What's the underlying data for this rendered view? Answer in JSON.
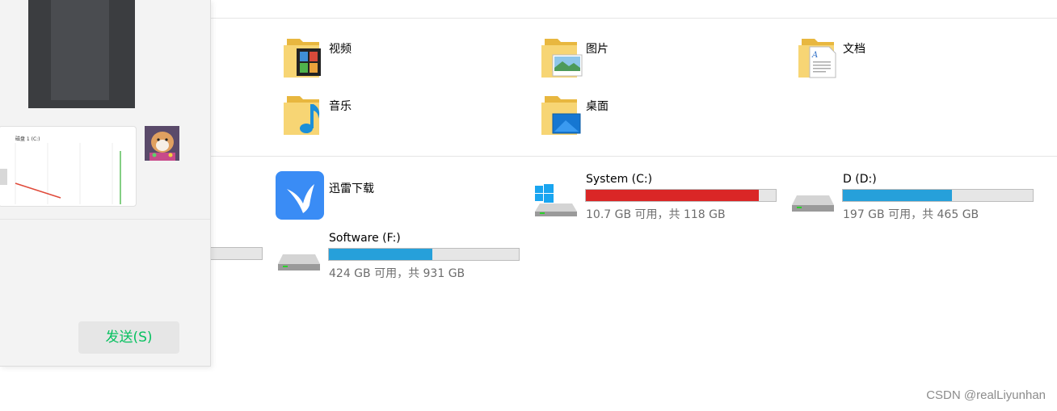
{
  "folders": {
    "videos": "视频",
    "pictures": "图片",
    "documents": "文档",
    "music": "音乐",
    "desktop": "桌面"
  },
  "devices": {
    "xunlei": {
      "label": "迅雷下载"
    },
    "c_drive": {
      "label": "System (C:)",
      "space": "10.7 GB 可用，共 118 GB",
      "used_fraction": 0.909,
      "bar_color": "#da2626"
    },
    "d_drive": {
      "label": "D (D:)",
      "space": "197 GB 可用，共 465 GB",
      "used_fraction": 0.576,
      "bar_color": "#26a0da"
    },
    "f_drive": {
      "label": "Software (F:)",
      "space": "424 GB 可用，共 931 GB",
      "used_fraction": 0.545,
      "bar_color": "#26a0da"
    }
  },
  "chat_panel": {
    "send_button": "发送(S)",
    "thumb_text": "磁盘 1 (C:)"
  },
  "watermark": "CSDN @realLiyunhan"
}
